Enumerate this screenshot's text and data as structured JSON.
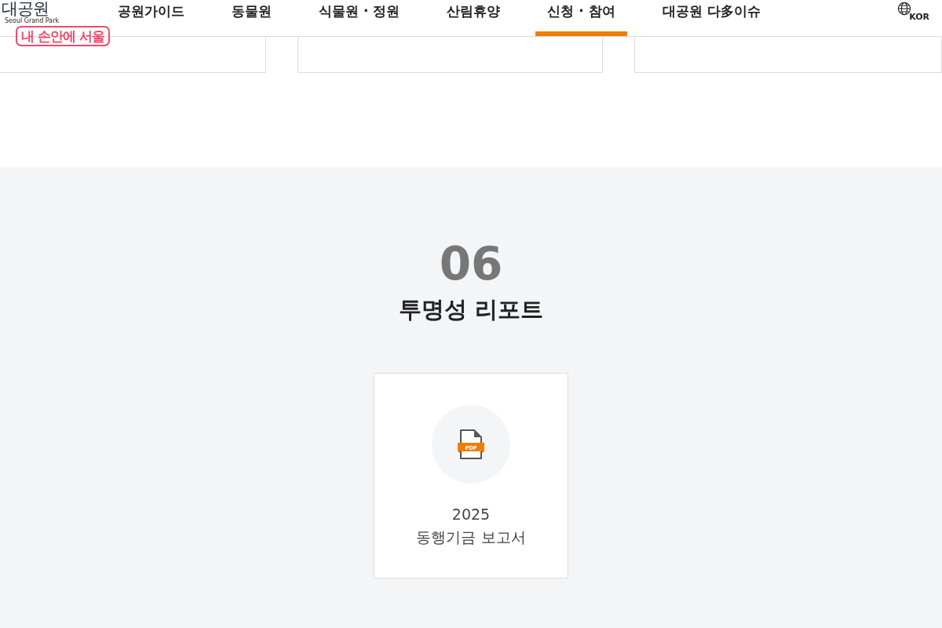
{
  "header": {
    "logo": {
      "title": "대공원",
      "subtitle": "Seoul Grand Park",
      "badge": "내 손안에 서울"
    },
    "nav": [
      {
        "label": "공원가이드",
        "selected": false
      },
      {
        "label": "동물원",
        "selected": false
      },
      {
        "label": "식물원 · 정원",
        "selected": false
      },
      {
        "label": "산림휴양",
        "selected": false
      },
      {
        "label": "신청 · 참여",
        "selected": true
      },
      {
        "label": "대공원 다多이슈",
        "selected": false
      }
    ],
    "language": "KOR"
  },
  "section": {
    "number": "06",
    "title": "투명성 리포트",
    "reports": [
      {
        "icon_label": "PDF",
        "year": "2025",
        "title": "동행기금 보고서"
      }
    ]
  }
}
